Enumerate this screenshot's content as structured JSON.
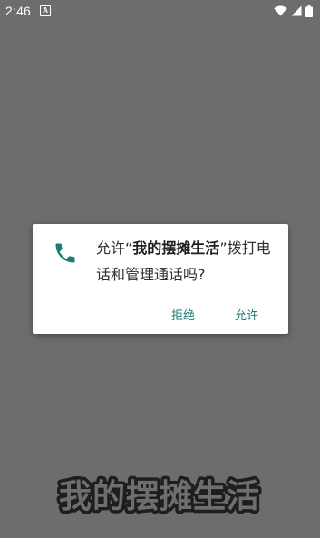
{
  "status_bar": {
    "time": "2:46",
    "notification_icon": "a-notification-icon",
    "icons": [
      "wifi-icon",
      "signal-icon",
      "battery-icon"
    ]
  },
  "dialog": {
    "icon": "phone-icon",
    "message_prefix": "允许“",
    "app_name": "我的摆摊生活",
    "message_suffix": "”拨打电话和管理通话吗?",
    "buttons": {
      "deny": "拒绝",
      "allow": "允许"
    }
  },
  "banner": {
    "text": "我的摆摊生活"
  },
  "colors": {
    "backdrop": "#6d6d6d",
    "accent": "#1b7d73",
    "dialog_bg": "#ffffff"
  }
}
